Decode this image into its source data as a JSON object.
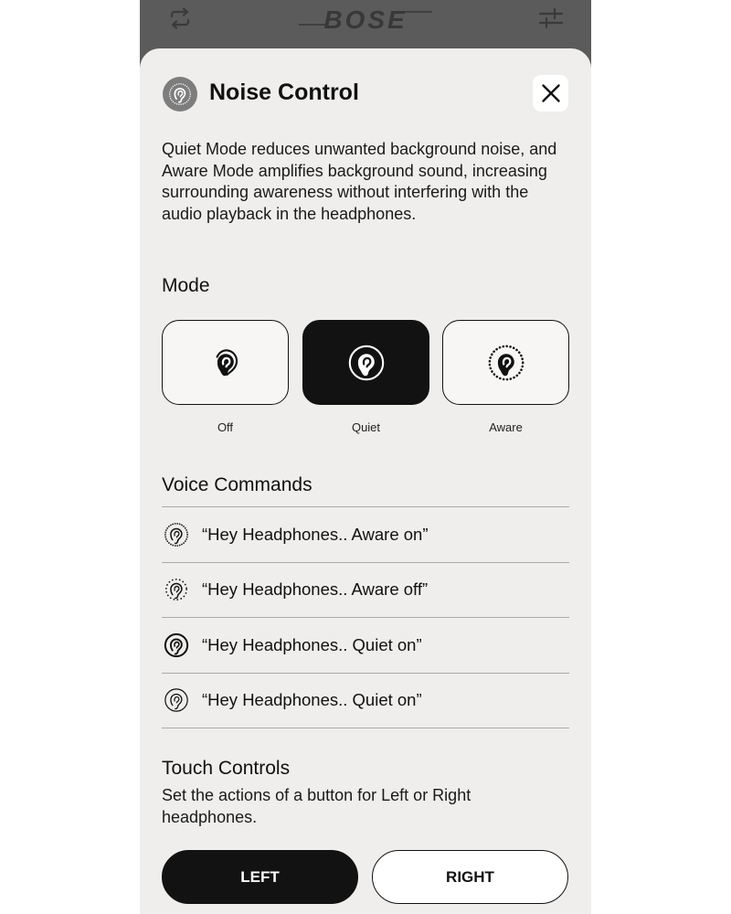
{
  "brand": {
    "logo_text": "BOSE"
  },
  "topbar": {
    "left_icon": "swap-icon",
    "right_icon": "sliders-icon"
  },
  "sheet": {
    "icon": "noise-control-ear-icon",
    "title": "Noise Control",
    "close_icon": "close-icon",
    "description": "Quiet Mode reduces unwanted background noise, and Aware Mode amplifies background sound, increasing surrounding awareness without interfering with the audio playback in the headphones."
  },
  "mode": {
    "heading": "Mode",
    "selected": "Quiet",
    "options": [
      {
        "label": "Off",
        "icon": "ear-off-icon"
      },
      {
        "label": "Quiet",
        "icon": "ear-quiet-icon"
      },
      {
        "label": "Aware",
        "icon": "ear-aware-icon"
      }
    ]
  },
  "voice_commands": {
    "heading": "Voice Commands",
    "items": [
      {
        "text": "“Hey Headphones.. Aware on”",
        "icon": "ear-aware-on-icon"
      },
      {
        "text": "“Hey Headphones.. Aware off”",
        "icon": "ear-aware-off-icon"
      },
      {
        "text": "“Hey Headphones.. Quiet on”",
        "icon": "ear-quiet-on-icon"
      },
      {
        "text": "“Hey Headphones.. Quiet on”",
        "icon": "ear-quiet-icon"
      }
    ]
  },
  "touch_controls": {
    "heading": "Touch Controls",
    "description": "Set the actions of a button for Left or Right headphones.",
    "selected": "LEFT",
    "buttons": [
      "LEFT",
      "RIGHT"
    ]
  },
  "colors": {
    "sheet_bg": "#efeeec",
    "dark": "#121212",
    "backdrop": "#5b5b5b"
  }
}
